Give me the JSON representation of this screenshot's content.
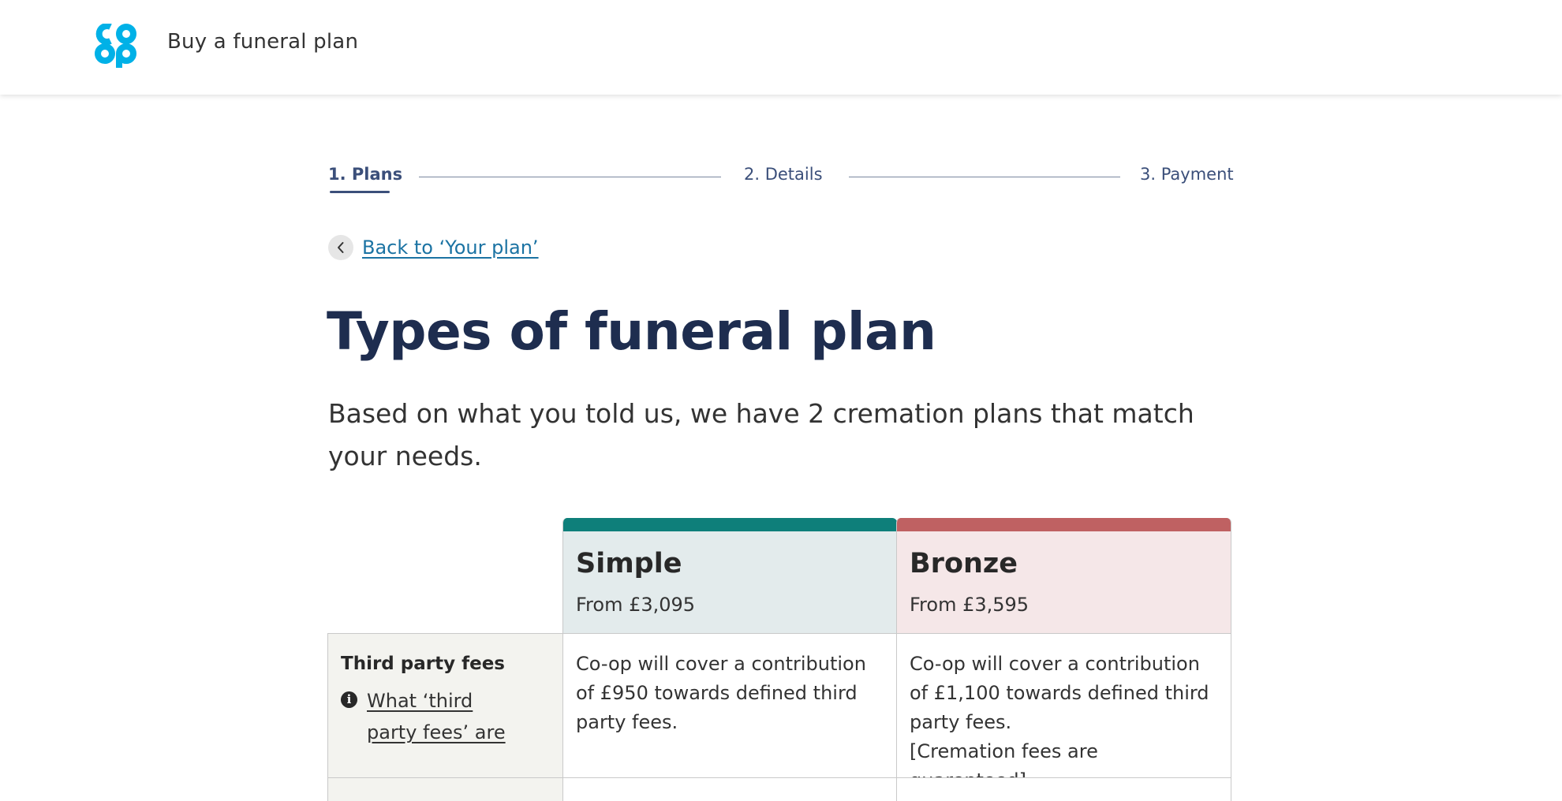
{
  "header": {
    "service_name": "Buy a funeral plan",
    "logo_label": "co-op",
    "logo_color": "#00b1e7"
  },
  "steps": [
    {
      "label": "1. Plans",
      "active": true
    },
    {
      "label": "2. Details",
      "active": false
    },
    {
      "label": "3. Payment",
      "active": false
    }
  ],
  "back_link": {
    "label": "Back to ‘Your plan’"
  },
  "page": {
    "title": "Types of funeral plan",
    "lead": "Based on what you told us, we have 2 cremation plans that match your needs."
  },
  "plans": [
    {
      "name": "Simple",
      "price": "From £3,095",
      "accent": "#0e7f7a",
      "background": "#e3ebec"
    },
    {
      "name": "Bronze",
      "price": "From £3,595",
      "accent": "#bf6162",
      "background": "#f5e7e8"
    }
  ],
  "rows": [
    {
      "label": "Third party fees",
      "help_link": "What ‘third party fees’ are",
      "help_icon": "info-icon",
      "simple": "Co-op will cover a contribution of £950 towards defined third party fees.",
      "bronze_line1": "Co-op will cover a contribution of £1,100 towards defined third party fees.",
      "bronze_line2": "[Cremation fees are guarenteed]"
    }
  ]
}
